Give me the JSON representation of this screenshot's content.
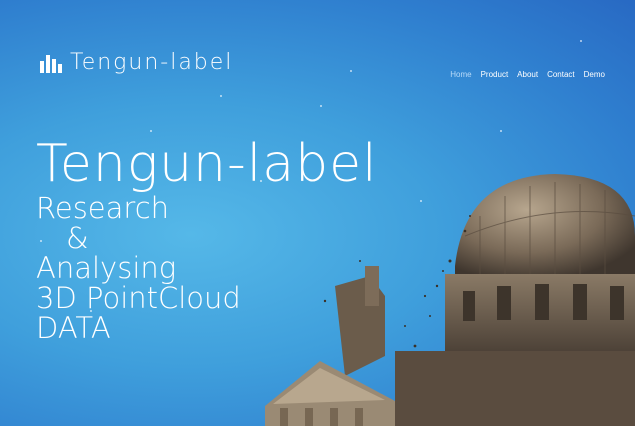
{
  "brand": {
    "name": "Tengun-label"
  },
  "nav": {
    "items": [
      "Home",
      "Product",
      "About",
      "Contact",
      "Demo"
    ],
    "active": "Home"
  },
  "hero": {
    "title": "Tengun-label",
    "line1": "Research",
    "line2": "&",
    "line3": "Analysing",
    "line4": "3D PointCloud",
    "line5": "DATA"
  },
  "colors": {
    "background": "#3f9fdc",
    "text": "#ffffff"
  },
  "icons": {
    "logo": "bar-chart-icon"
  }
}
